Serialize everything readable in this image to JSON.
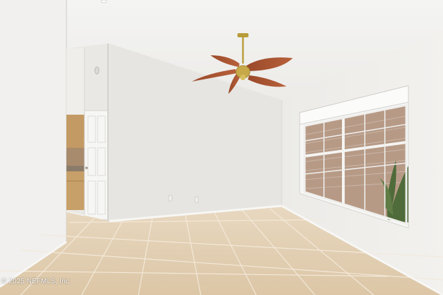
{
  "photo": {
    "watermark": "© 2025 NEFMLS, Inc"
  }
}
